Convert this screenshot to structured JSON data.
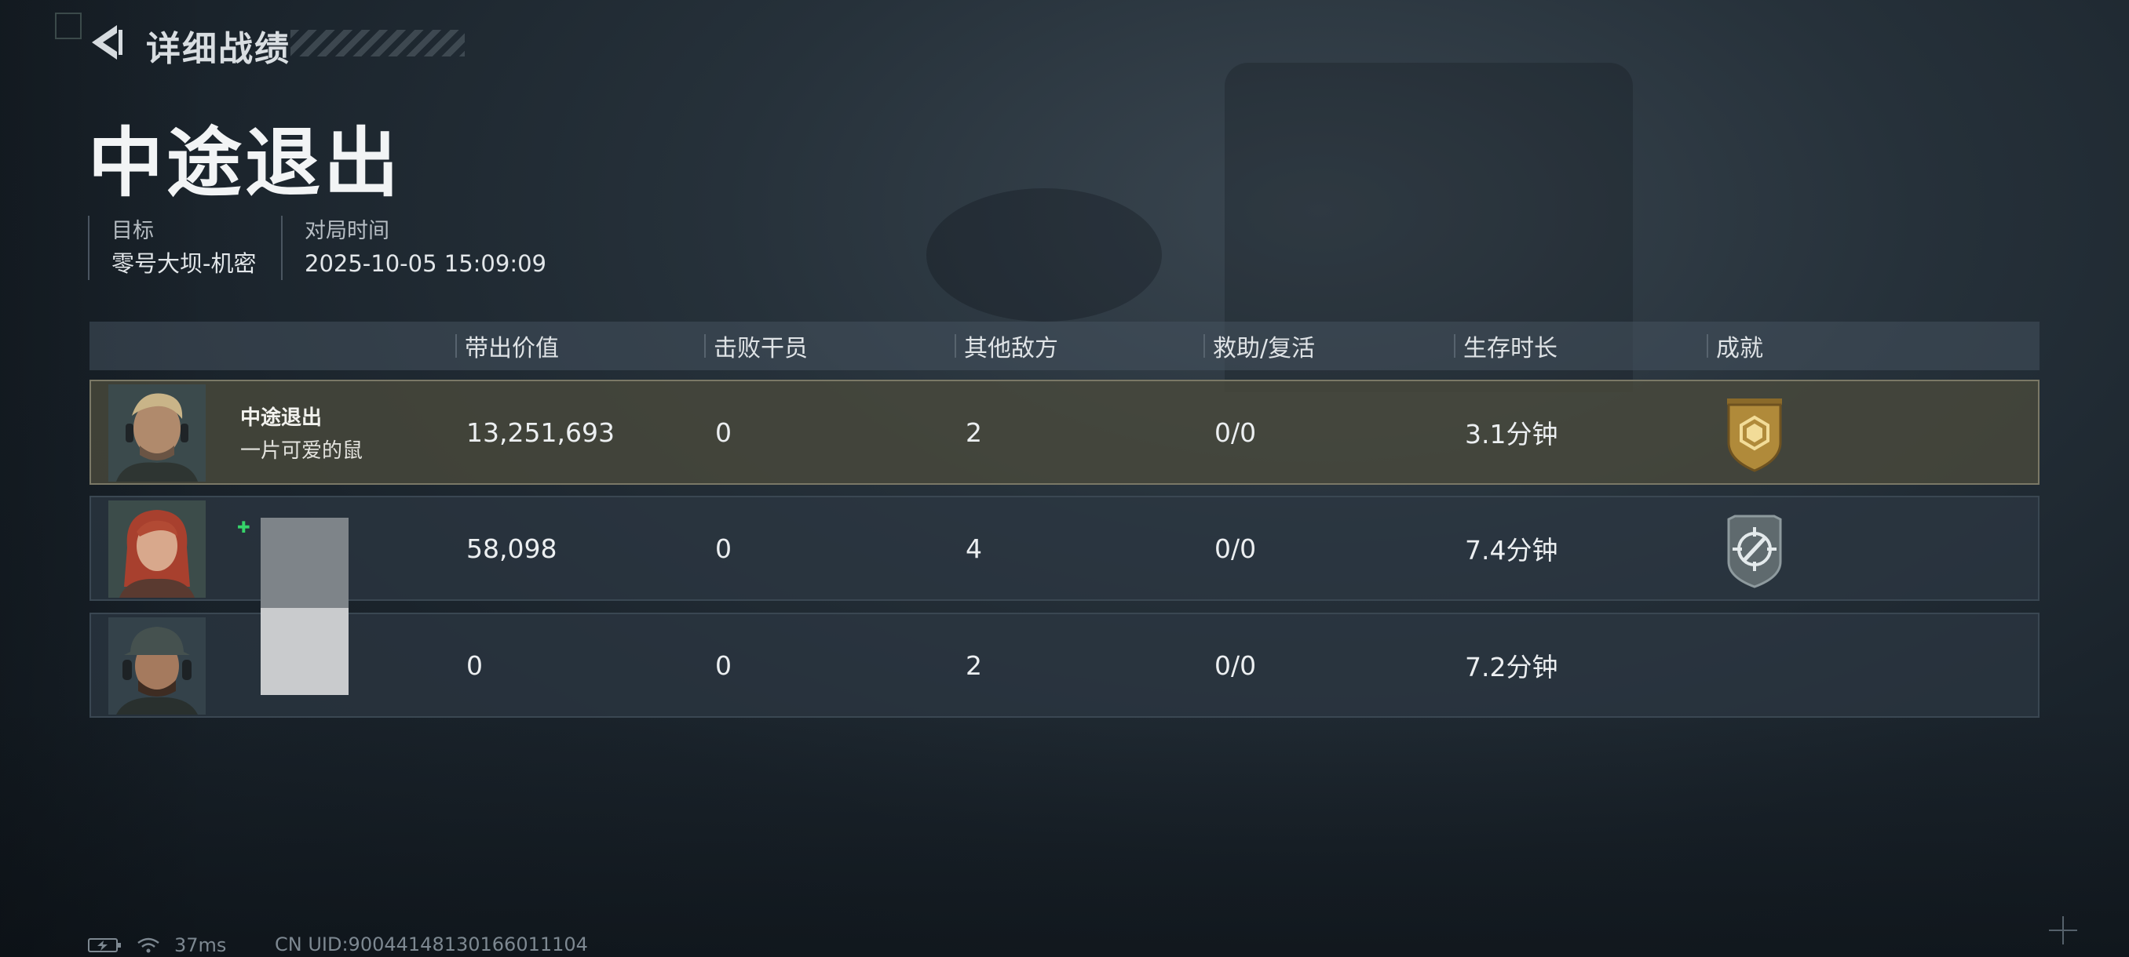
{
  "header": {
    "back_icon": "back-arrow-icon",
    "title": "详细战绩"
  },
  "result_title": "中途退出",
  "meta": {
    "target_label": "目标",
    "target_value": "零号大坝-机密",
    "time_label": "对局时间",
    "time_value": "2025-10-05 15:09:09"
  },
  "table": {
    "columns": [
      "带出价值",
      "击败干员",
      "其他敌方",
      "救助/复活",
      "生存时长",
      "成就"
    ],
    "rows": [
      {
        "player_name": "中途退出",
        "player_sub": "一片可爱的鼠",
        "value": "13,251,693",
        "kills": "0",
        "other_enemies": "2",
        "assist_revive": "0/0",
        "survival": "3.1分钟",
        "achievement_icon": "gold-shield-badge-icon",
        "highlighted": true
      },
      {
        "player_name": "",
        "player_sub": "",
        "value": "58,098",
        "kills": "0",
        "other_enemies": "4",
        "assist_revive": "0/0",
        "survival": "7.4分钟",
        "achievement_icon": "silver-crosshair-badge-icon",
        "highlighted": false
      },
      {
        "player_name": "",
        "player_sub": "",
        "value": "0",
        "kills": "0",
        "other_enemies": "2",
        "assist_revive": "0/0",
        "survival": "7.2分钟",
        "achievement_icon": "",
        "highlighted": false
      }
    ]
  },
  "status": {
    "latency": "37ms",
    "uid": "CN UID:90044148130166011104"
  },
  "colors": {
    "highlight_row": "#4a4a3c",
    "gold_badge": "#b08a3a",
    "silver_badge": "#5f6a6e"
  }
}
